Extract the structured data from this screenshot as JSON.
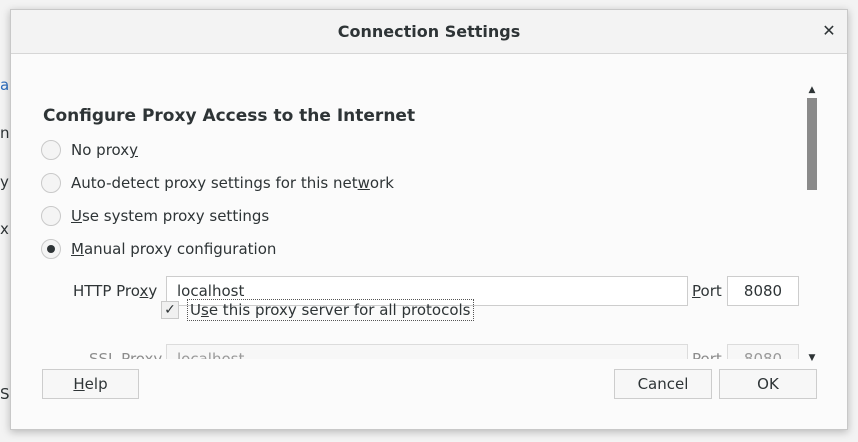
{
  "background_fragments": [
    "al",
    "n",
    "y",
    "x",
    "S"
  ],
  "dialog": {
    "title": "Connection Settings",
    "close_icon": "close-icon",
    "heading": "Configure Proxy Access to the Internet",
    "radios": [
      {
        "pre": "No prox",
        "u": "y",
        "post": "",
        "checked": false
      },
      {
        "pre": "Auto-detect proxy settings for this net",
        "u": "w",
        "post": "ork",
        "checked": false
      },
      {
        "pre": "",
        "u": "U",
        "post": "se system proxy settings",
        "checked": false
      },
      {
        "pre": "",
        "u": "M",
        "post": "anual proxy configuration",
        "checked": true
      }
    ],
    "http": {
      "label_pre": "HTTP Pro",
      "label_u": "x",
      "label_post": "y",
      "value": "localhost",
      "port_label_u": "P",
      "port_label_post": "ort",
      "port_value": "8080"
    },
    "use_all": {
      "checked_glyph": "✓",
      "label_pre": "U",
      "label_u": "s",
      "label_post": "e this proxy server for all protocols"
    },
    "ssl": {
      "label_pre": "SS",
      "label_u": "L",
      "label_post": " Proxy",
      "placeholder": "localhost",
      "port_label_pre": "Por",
      "port_label_u": "t",
      "port_placeholder": "8080"
    },
    "buttons": {
      "help_u": "H",
      "help_post": "elp",
      "cancel": "Cancel",
      "ok": "OK"
    }
  },
  "colors": {
    "accent": "#2e3436",
    "link": "#2a6bbd",
    "scroll_thumb": "#8a8a8a"
  }
}
